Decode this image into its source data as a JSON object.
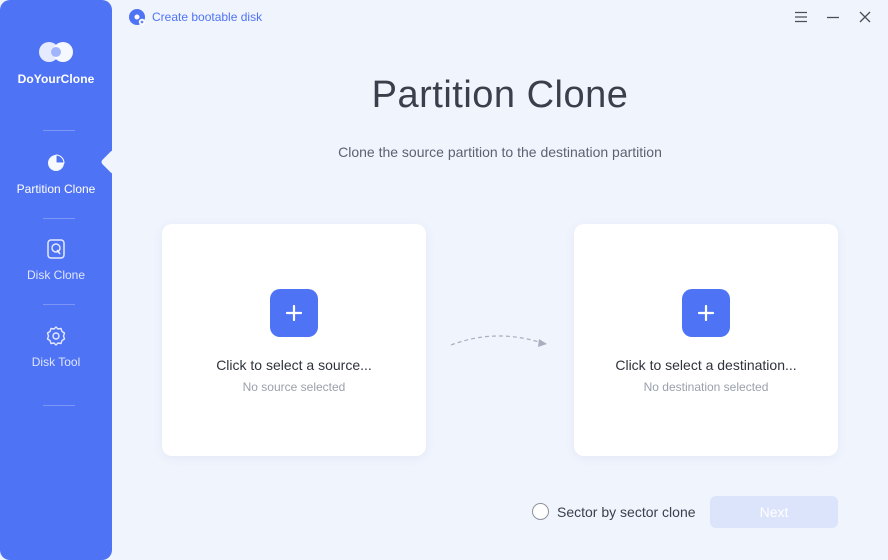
{
  "app": {
    "name": "DoYourClone"
  },
  "topbar": {
    "bootable_link": "Create bootable disk"
  },
  "window_controls": [
    "menu-icon",
    "minimize-icon",
    "close-icon"
  ],
  "sidebar": {
    "items": [
      {
        "label": "Partition Clone",
        "icon": "pie-chart-icon",
        "active": true
      },
      {
        "label": "Disk Clone",
        "icon": "disk-icon",
        "active": false
      },
      {
        "label": "Disk Tool",
        "icon": "gear-icon",
        "active": false
      }
    ]
  },
  "main": {
    "title": "Partition Clone",
    "subtitle": "Clone the source partition to the destination partition",
    "source": {
      "title": "Click to select a source...",
      "status": "No source selected"
    },
    "destination": {
      "title": "Click to select a destination...",
      "status": "No destination selected"
    },
    "sector_option": {
      "label": "Sector by sector clone",
      "checked": false
    },
    "next_button": {
      "label": "Next",
      "enabled": false
    }
  },
  "colors": {
    "accent": "#4f73f5",
    "background": "#f0f4fd",
    "disabled_button": "#dbe4fb"
  }
}
